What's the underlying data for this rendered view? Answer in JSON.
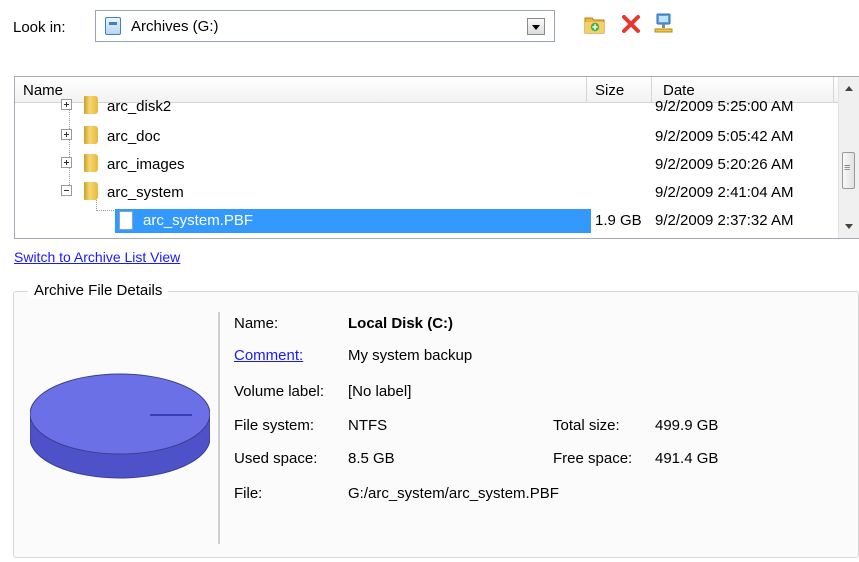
{
  "toolbar": {
    "look_in_label": "Look in:",
    "location": "Archives (G:)"
  },
  "tree": {
    "columns": {
      "name": "Name",
      "size": "Size",
      "date": "Date"
    },
    "rows": [
      {
        "name": "arc_disk2",
        "size": "",
        "date": "9/2/2009 5:25:00 AM",
        "type": "folder",
        "expander": "plus"
      },
      {
        "name": "arc_doc",
        "size": "",
        "date": "9/2/2009 5:05:42 AM",
        "type": "folder",
        "expander": "plus"
      },
      {
        "name": "arc_images",
        "size": "",
        "date": "9/2/2009 5:20:26 AM",
        "type": "folder",
        "expander": "plus"
      },
      {
        "name": "arc_system",
        "size": "",
        "date": "9/2/2009 2:41:04 AM",
        "type": "folder",
        "expander": "minus"
      },
      {
        "name": "arc_system.PBF",
        "size": "1.9 GB",
        "date": "9/2/2009 2:37:32 AM",
        "type": "file",
        "selected": true
      }
    ]
  },
  "switch_link": "Switch to Archive List View",
  "details": {
    "title": "Archive File Details",
    "name_label": "Name:",
    "name_value": "Local Disk (C:)",
    "comment_label": "Comment:",
    "comment_value": "My system backup",
    "volume_label_label": "Volume label:",
    "volume_label_value": "[No label]",
    "file_system_label": "File system:",
    "file_system_value": "NTFS",
    "total_size_label": "Total size:",
    "total_size_value": "499.9 GB",
    "used_space_label": "Used space:",
    "used_space_value": "8.5 GB",
    "free_space_label": "Free space:",
    "free_space_value": "491.4 GB",
    "file_label": "File:",
    "file_value": "G:/arc_system/arc_system.PBF"
  },
  "colors": {
    "selection": "#3399ff",
    "link": "#1a1aff",
    "disk": "#6c70e6"
  },
  "icons": [
    "drive-icon",
    "new-folder-icon",
    "delete-icon",
    "network-icon",
    "folder-icon",
    "file-icon",
    "disk-icon"
  ]
}
